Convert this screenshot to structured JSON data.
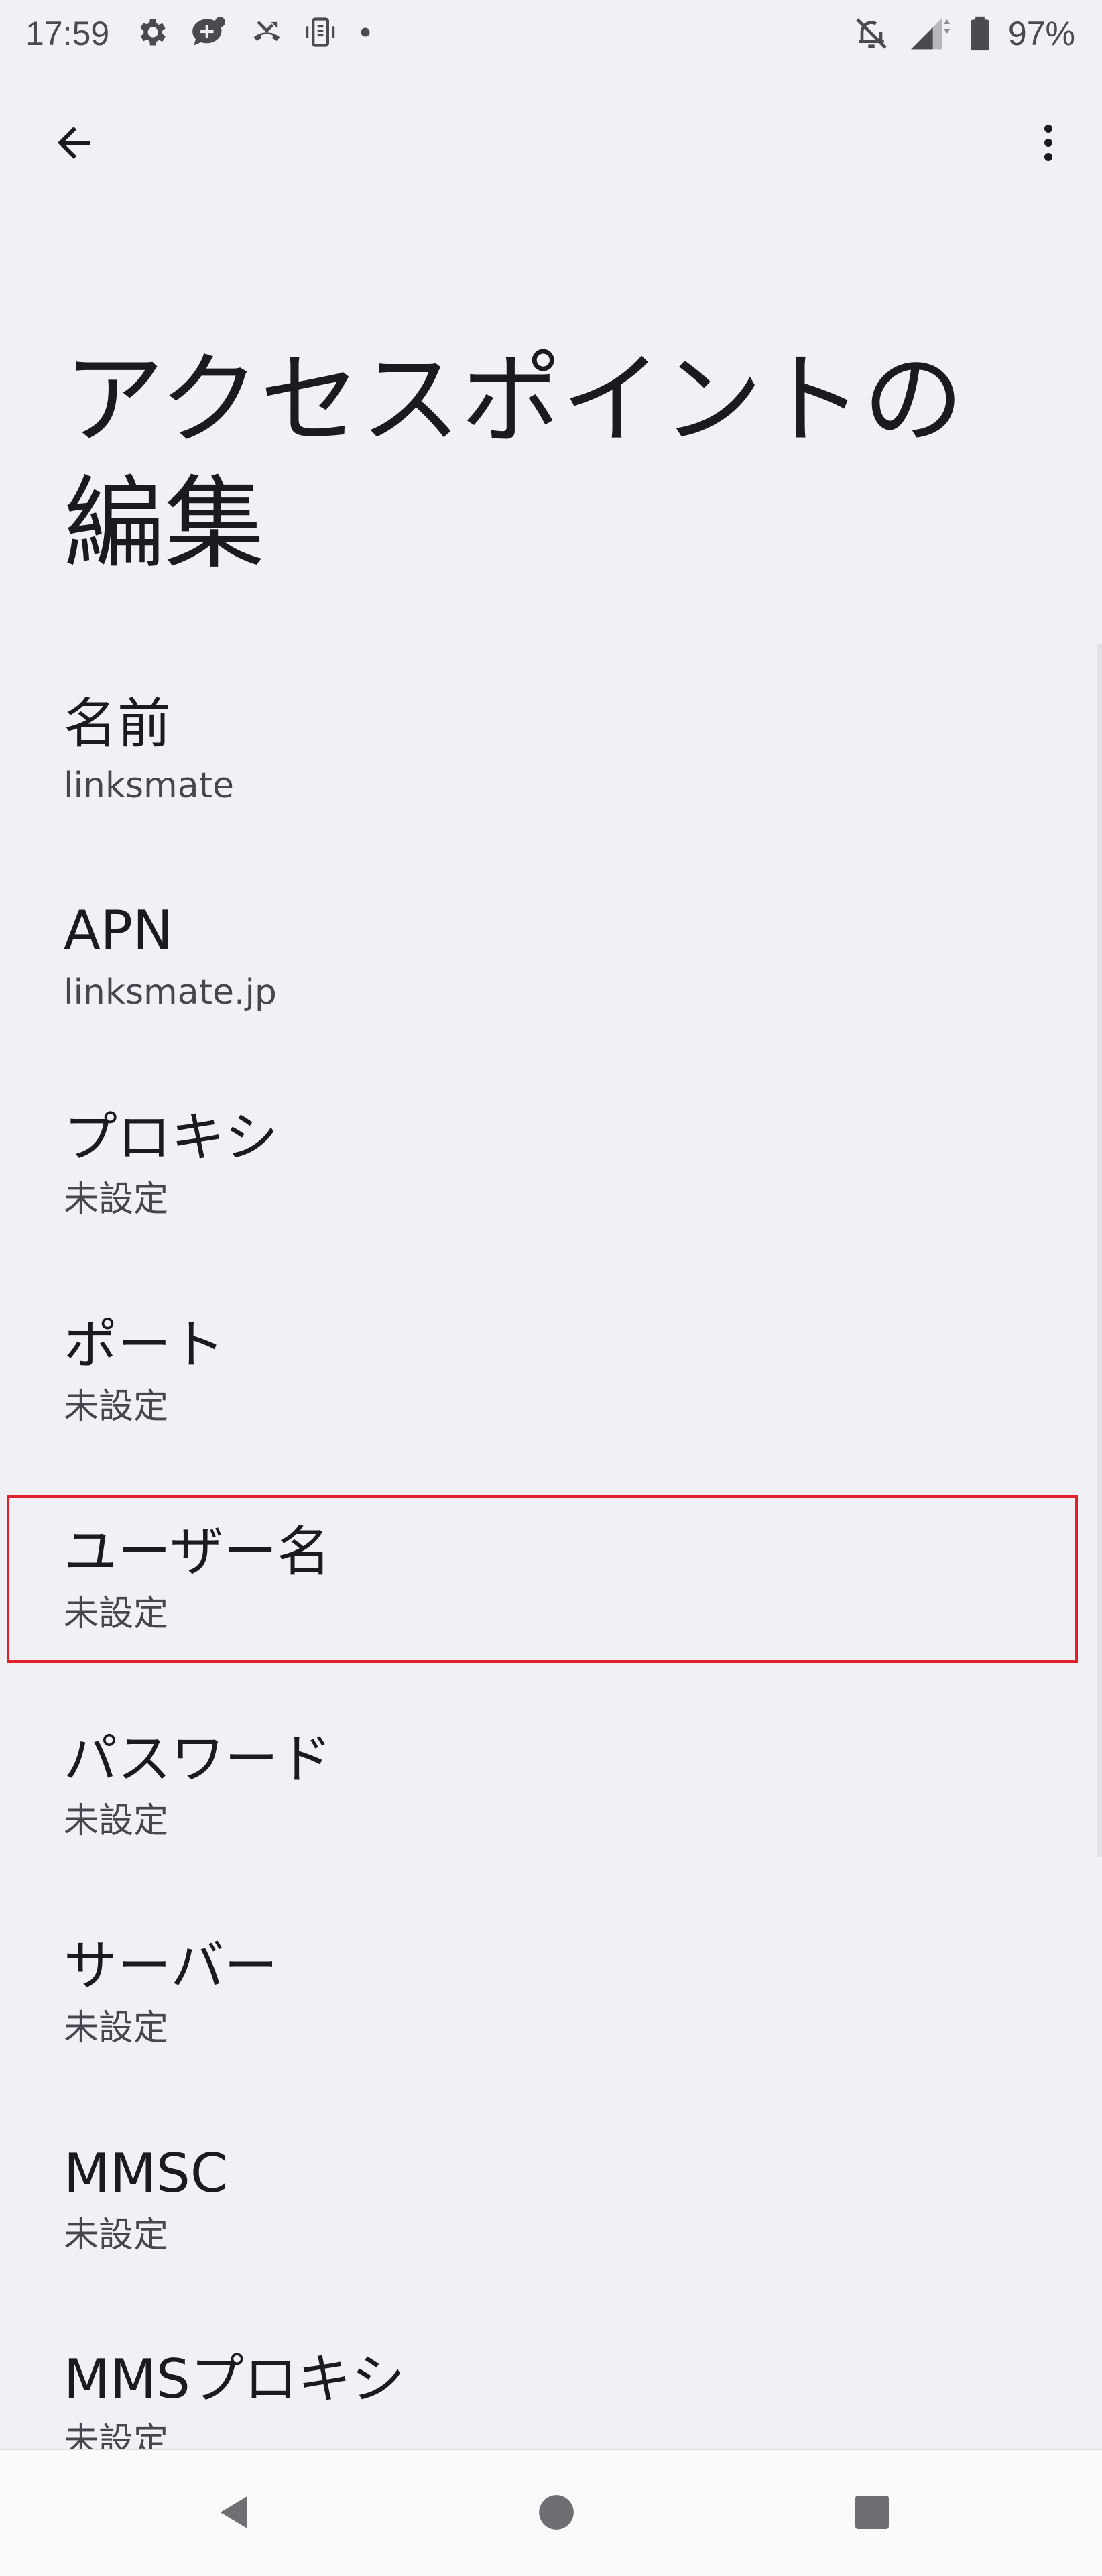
{
  "status_bar": {
    "time": "17:59",
    "left_icons": [
      "gear-icon",
      "chat-add-icon",
      "missed-call-icon",
      "vibrate-icon",
      "dot-icon"
    ],
    "right_icons": [
      "bell-off-icon",
      "signal-icon",
      "battery-icon"
    ],
    "battery_percent": "97%"
  },
  "top_bar": {
    "back_icon": "arrow-left-icon",
    "more_icon": "more-vert-icon"
  },
  "page": {
    "title": "アクセスポイントの編集"
  },
  "preferences": [
    {
      "title": "名前",
      "summary": "linksmate"
    },
    {
      "title": "APN",
      "summary": "linksmate.jp"
    },
    {
      "title": "プロキシ",
      "summary": "未設定"
    },
    {
      "title": "ポート",
      "summary": "未設定"
    },
    {
      "title": "ユーザー名",
      "summary": "未設定",
      "highlighted": true
    },
    {
      "title": "パスワード",
      "summary": "未設定"
    },
    {
      "title": "サーバー",
      "summary": "未設定"
    },
    {
      "title": "MMSC",
      "summary": "未設定"
    },
    {
      "title": "MMSプロキシ",
      "summary": "未設定"
    }
  ],
  "highlight_color": "#e0202a",
  "nav_bar": {
    "back_icon": "triangle-back-icon",
    "home_icon": "circle-home-icon",
    "recents_icon": "square-recents-icon"
  }
}
